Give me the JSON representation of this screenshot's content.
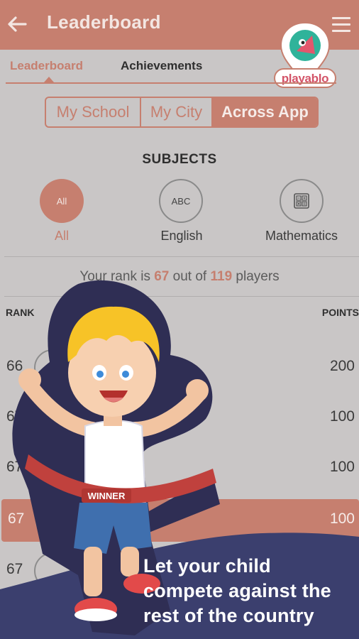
{
  "header": {
    "title": "Leaderboard"
  },
  "logo": {
    "text": "playablo"
  },
  "tabs": [
    {
      "label": "Leaderboard",
      "active": true
    },
    {
      "label": "Achievements",
      "active": false
    }
  ],
  "scope": {
    "options": [
      "My School",
      "My City",
      "Across App"
    ],
    "selected": "Across App"
  },
  "subjects": {
    "heading": "SUBJECTS",
    "items": [
      {
        "icon_text": "All",
        "label": "All",
        "selected": true
      },
      {
        "icon_text": "ABC",
        "label": "English",
        "selected": false
      },
      {
        "icon": "calculator-icon",
        "label": "Mathematics",
        "selected": false
      }
    ]
  },
  "rank_summary": {
    "prefix": "Your rank is ",
    "rank": "67",
    "middle": " out of ",
    "total": "119",
    "suffix": " players"
  },
  "table": {
    "col_rank": "RANK",
    "col_points": "POINTS",
    "rows": [
      {
        "rank": "66",
        "points": "200"
      },
      {
        "rank": "67",
        "points": "100"
      },
      {
        "rank": "67",
        "points": "100"
      },
      {
        "rank": "67",
        "points": "100",
        "current_user": true
      },
      {
        "rank": "67",
        "points": ""
      }
    ]
  },
  "promo": {
    "ribbon_text": "WINNER",
    "line1": "Let your child",
    "line2": "compete against the",
    "line3": "rest of the country"
  },
  "colors": {
    "accent": "#c67f6f",
    "banner": "#3b3f6e",
    "background": "#c9c6c6"
  }
}
